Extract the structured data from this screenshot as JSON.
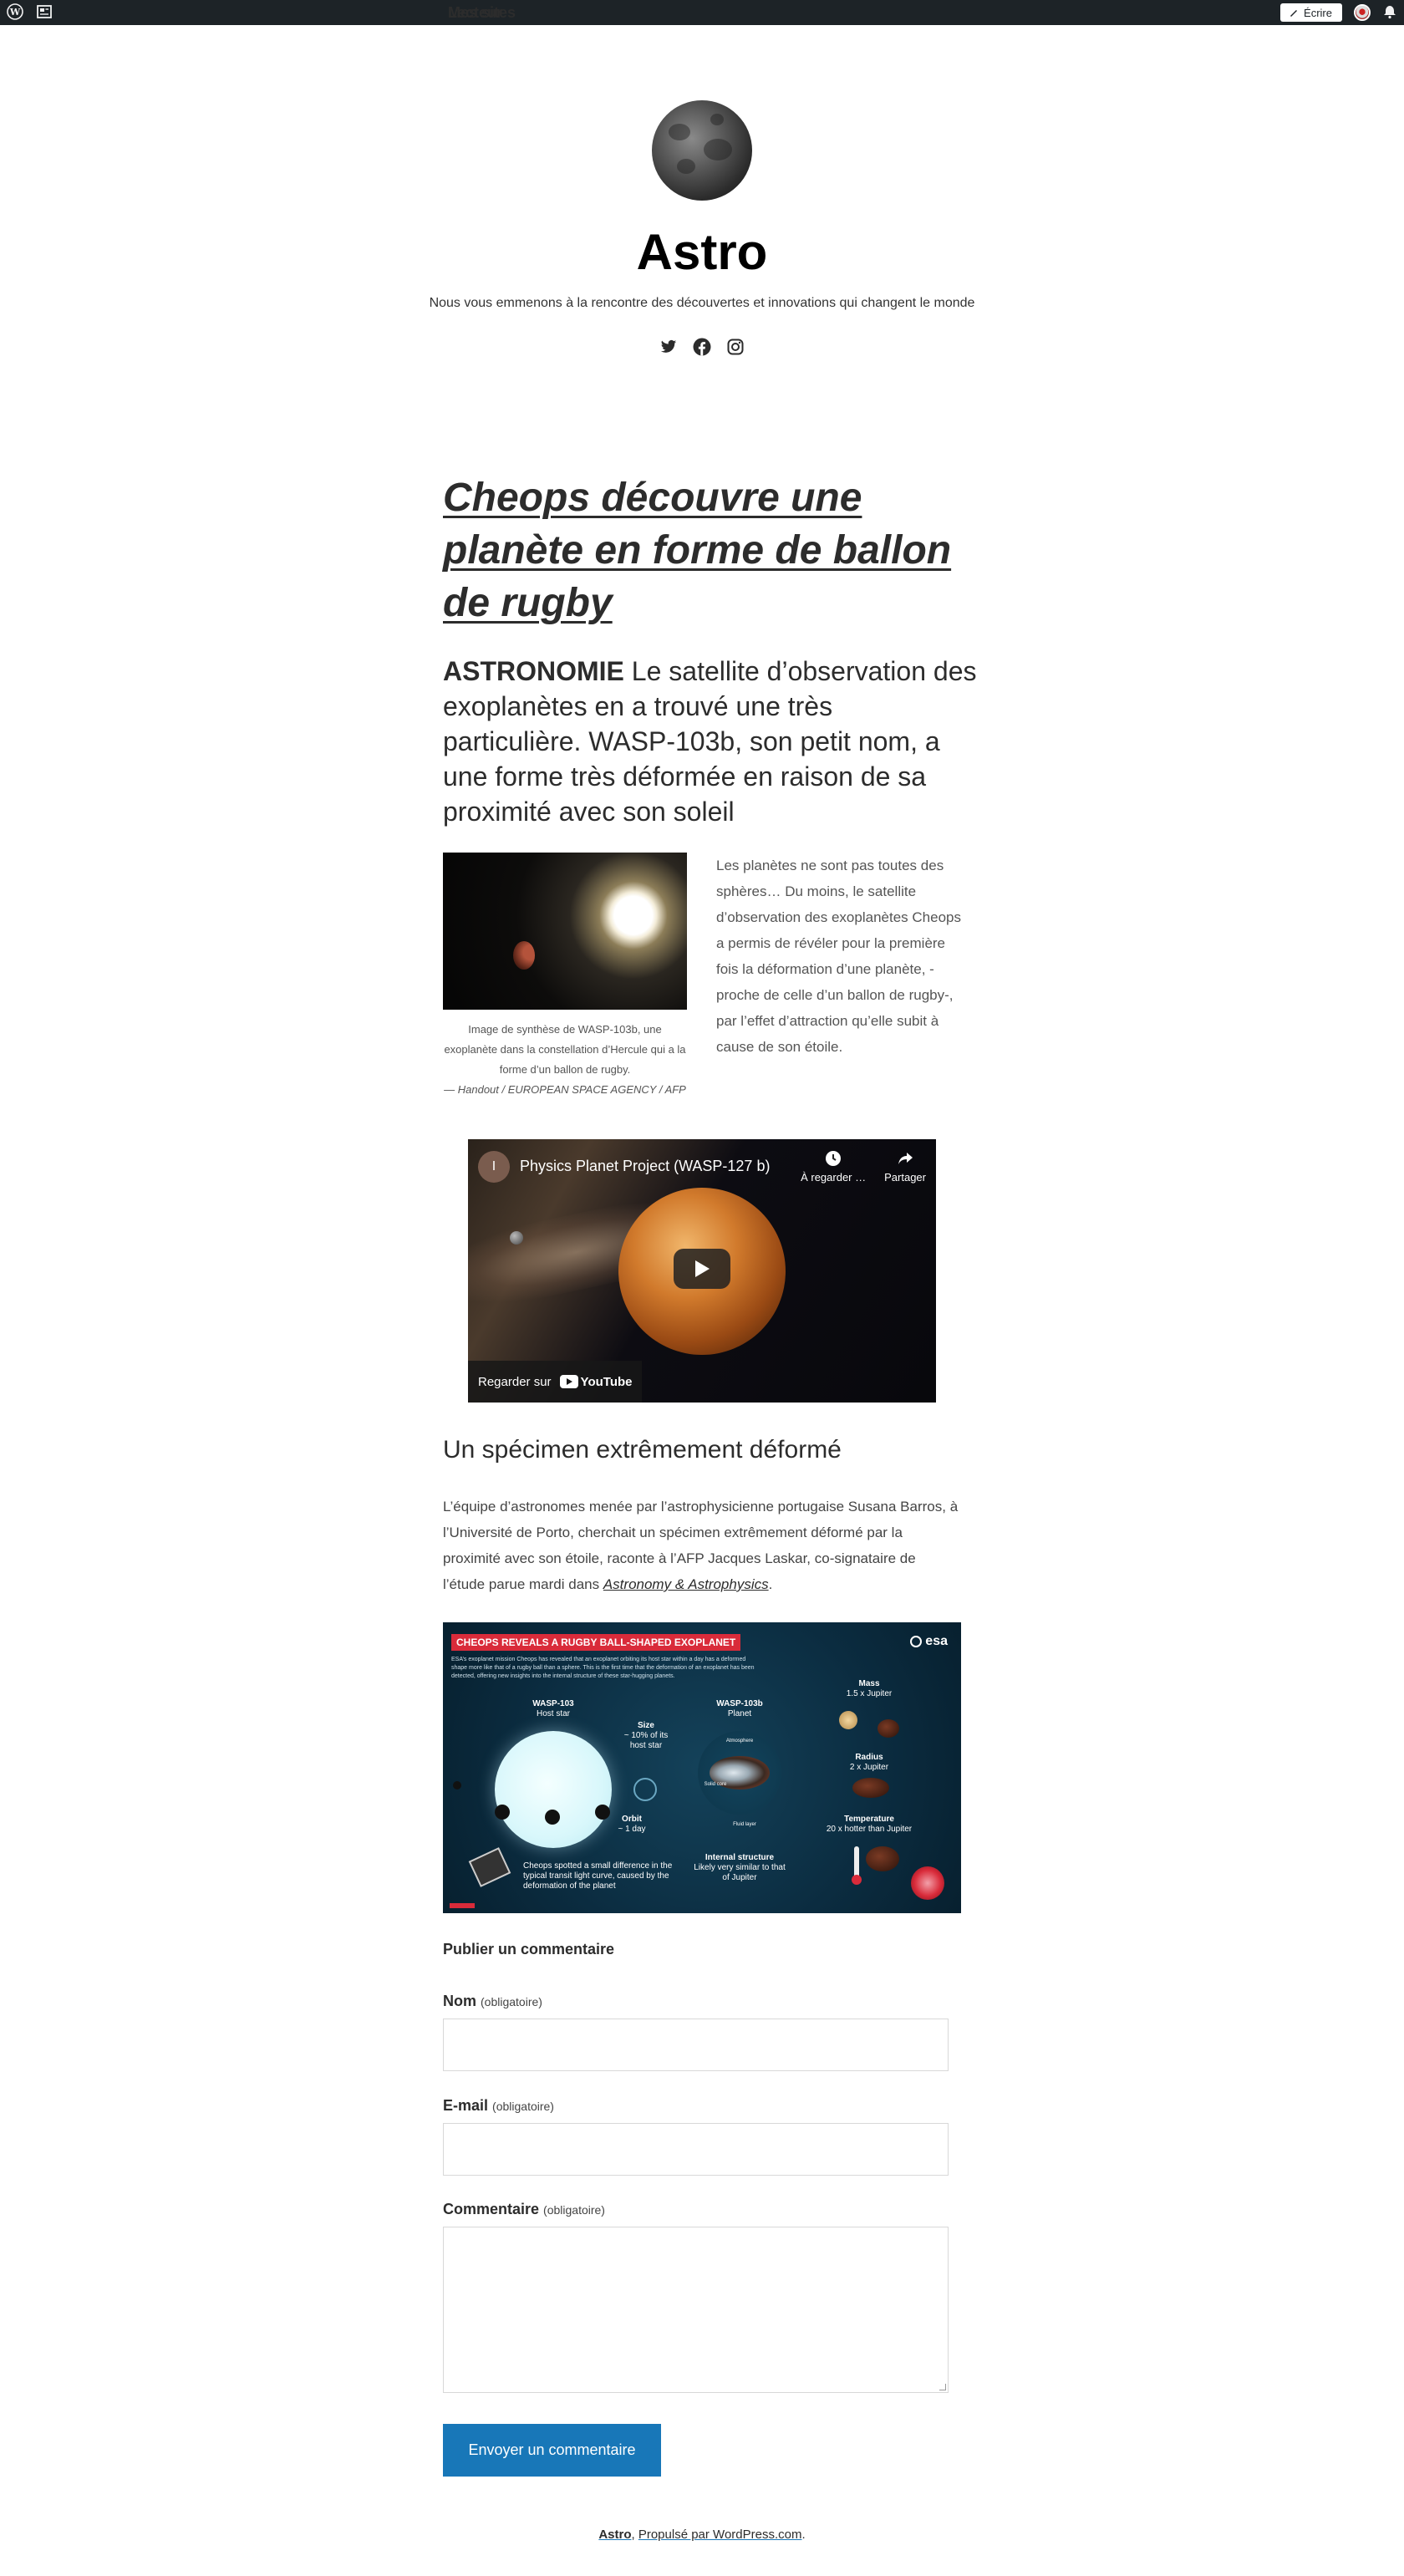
{
  "adminbar": {
    "my_sites": "Mes sites",
    "reader": "Lecteur",
    "write": "Écrire"
  },
  "header": {
    "title": "Astro",
    "description": "Nous vous emmenons à la rencontre des découvertes et innovations qui changent le monde",
    "social": [
      "twitter-icon",
      "facebook-icon",
      "instagram-icon"
    ]
  },
  "post": {
    "title": "Cheops découvre une planète en forme de ballon de rugby",
    "lead_kicker": "ASTRONOMIE",
    "lead_text": " Le satellite d’observation des exoplanètes en a trouvé une très particulière. WASP-103b, son petit nom, a une forme très déformée en raison de sa proximité avec son soleil",
    "figure": {
      "caption": "Image de synthèse de WASP-103b, une exoplanète dans la constellation d’Hercule qui a la forme d’un ballon de rugby.",
      "credit": "— Handout / EUROPEAN SPACE AGENCY / AFP"
    },
    "side_text": "Les planètes ne sont pas toutes des sphères… Du moins, le satellite d’observation des exoplanètes Cheops a permis de révéler pour la première fois la déformation d’une planète, - proche de celle d’un ballon de rugby-, par l’effet d’attraction qu’elle subit à cause de son étoile.",
    "video": {
      "channel_initial": "I",
      "title": "Physics Planet Project (WASP-127 b)",
      "watch_later": "À regarder …",
      "share": "Partager",
      "watch_on": "Regarder sur",
      "youtube": "YouTube"
    },
    "subheading": "Un spécimen extrêmement déformé",
    "paragraph_text": "L’équipe d’astronomes menée par l’astrophysicienne portugaise Susana Barros, à l’Université de Porto, cherchait un spécimen extrêmement déformé par la proximité avec son étoile, raconte à l’AFP Jacques Laskar, co-signataire de l’étude parue mardi dans ",
    "paragraph_link": "Astronomy & Astrophysics",
    "paragraph_end": ".",
    "infographic": {
      "banner": "CHEOPS REVEALS A RUGBY BALL-SHAPED EXOPLANET",
      "esa": "esa",
      "intro": "ESA’s exoplanet mission Cheops has revealed that an exoplanet orbiting its host star within a day has a deformed shape more like that of a rugby ball than a sphere. This is the first time that the deformation of an exoplanet has been detected, offering new insights into the internal structure of these star-hugging planets.",
      "star_name": "WASP-103",
      "star_sub": "Host star",
      "planet_name": "WASP-103b",
      "planet_sub": "Planet",
      "size_label": "Size",
      "size_value": "~ 10% of its host star",
      "orbit_label": "Orbit",
      "orbit_value": "~ 1 day",
      "atmosphere": "Atmosphere",
      "solid_core": "Solid core",
      "fluid_layer": "Fluid layer",
      "internal_label": "Internal structure",
      "internal_value": "Likely very similar to that of Jupiter",
      "mass_label": "Mass",
      "mass_value": "1.5 x Jupiter",
      "radius_label": "Radius",
      "radius_value": "2 x Jupiter",
      "temp_label": "Temperature",
      "temp_value": "20 x hotter than Jupiter",
      "cheops_note": "Cheops spotted a small difference in the typical transit light curve, caused by the deformation of the planet"
    }
  },
  "comments": {
    "title": "Publier un commentaire",
    "name_label": "Nom",
    "email_label": "E-mail",
    "comment_label": "Commentaire",
    "required": "(obligatoire)",
    "name_value": "",
    "email_value": "",
    "comment_value": "",
    "submit": "Envoyer un commentaire"
  },
  "footer": {
    "site": "Astro",
    "separator": ", ",
    "powered": "Propulsé par WordPress.com",
    "end": "."
  }
}
